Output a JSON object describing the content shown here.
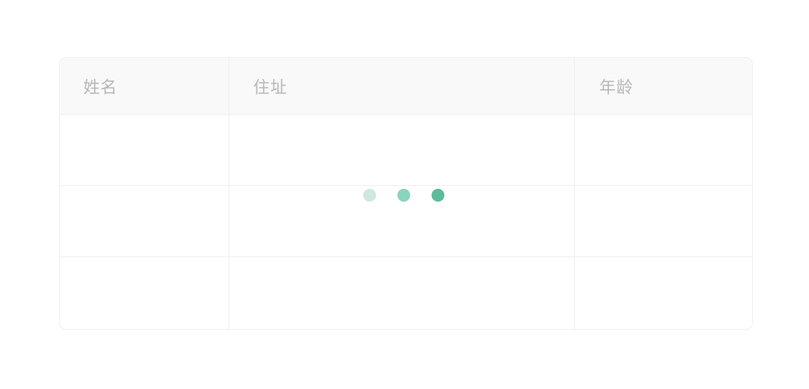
{
  "table": {
    "columns": [
      {
        "label": "姓名"
      },
      {
        "label": "住址"
      },
      {
        "label": "年龄"
      }
    ],
    "rows": [
      [
        "",
        "",
        ""
      ],
      [
        "",
        "",
        ""
      ],
      [
        "",
        "",
        ""
      ]
    ]
  },
  "loader": {
    "state": "loading",
    "dot_colors": [
      "#cde8e0",
      "#88d4bd",
      "#5cbb9b"
    ]
  }
}
